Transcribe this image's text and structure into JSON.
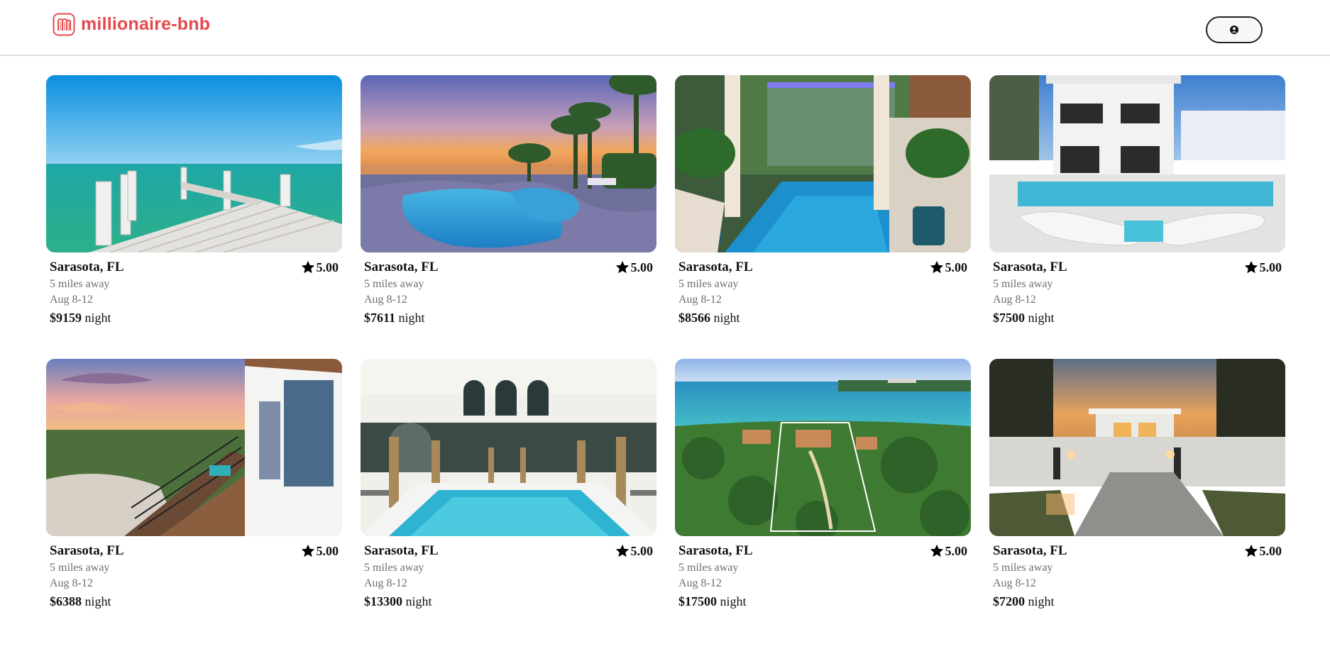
{
  "app": {
    "logo_text": "millionaire-bnb",
    "logo_icon": "logo-icon",
    "brand_color": "#e5484d",
    "profile_icon": "user-circle-icon"
  },
  "listings": [
    {
      "location": "Sarasota, FL",
      "rating": "5.00",
      "distance": "5 miles away",
      "dates": "Aug 8-12",
      "price": "$9159",
      "price_unit": "night",
      "photo": "dock-ocean"
    },
    {
      "location": "Sarasota, FL",
      "rating": "5.00",
      "distance": "5 miles away",
      "dates": "Aug 8-12",
      "price": "$7611",
      "price_unit": "night",
      "photo": "sunset-pool"
    },
    {
      "location": "Sarasota, FL",
      "rating": "5.00",
      "distance": "5 miles away",
      "dates": "Aug 8-12",
      "price": "$8566",
      "price_unit": "night",
      "photo": "waterfall-pool"
    },
    {
      "location": "Sarasota, FL",
      "rating": "5.00",
      "distance": "5 miles away",
      "dates": "Aug 8-12",
      "price": "$7500",
      "price_unit": "night",
      "photo": "modern-house-pool"
    },
    {
      "location": "Sarasota, FL",
      "rating": "5.00",
      "distance": "5 miles away",
      "dates": "Aug 8-12",
      "price": "$6388",
      "price_unit": "night",
      "photo": "beach-deck"
    },
    {
      "location": "Sarasota, FL",
      "rating": "5.00",
      "distance": "5 miles away",
      "dates": "Aug 8-12",
      "price": "$13300",
      "price_unit": "night",
      "photo": "indoor-pool-columns"
    },
    {
      "location": "Sarasota, FL",
      "rating": "5.00",
      "distance": "5 miles away",
      "dates": "Aug 8-12",
      "price": "$17500",
      "price_unit": "night",
      "photo": "aerial-estate"
    },
    {
      "location": "Sarasota, FL",
      "rating": "5.00",
      "distance": "5 miles away",
      "dates": "Aug 8-12",
      "price": "$7200",
      "price_unit": "night",
      "photo": "modern-house-dusk"
    }
  ]
}
